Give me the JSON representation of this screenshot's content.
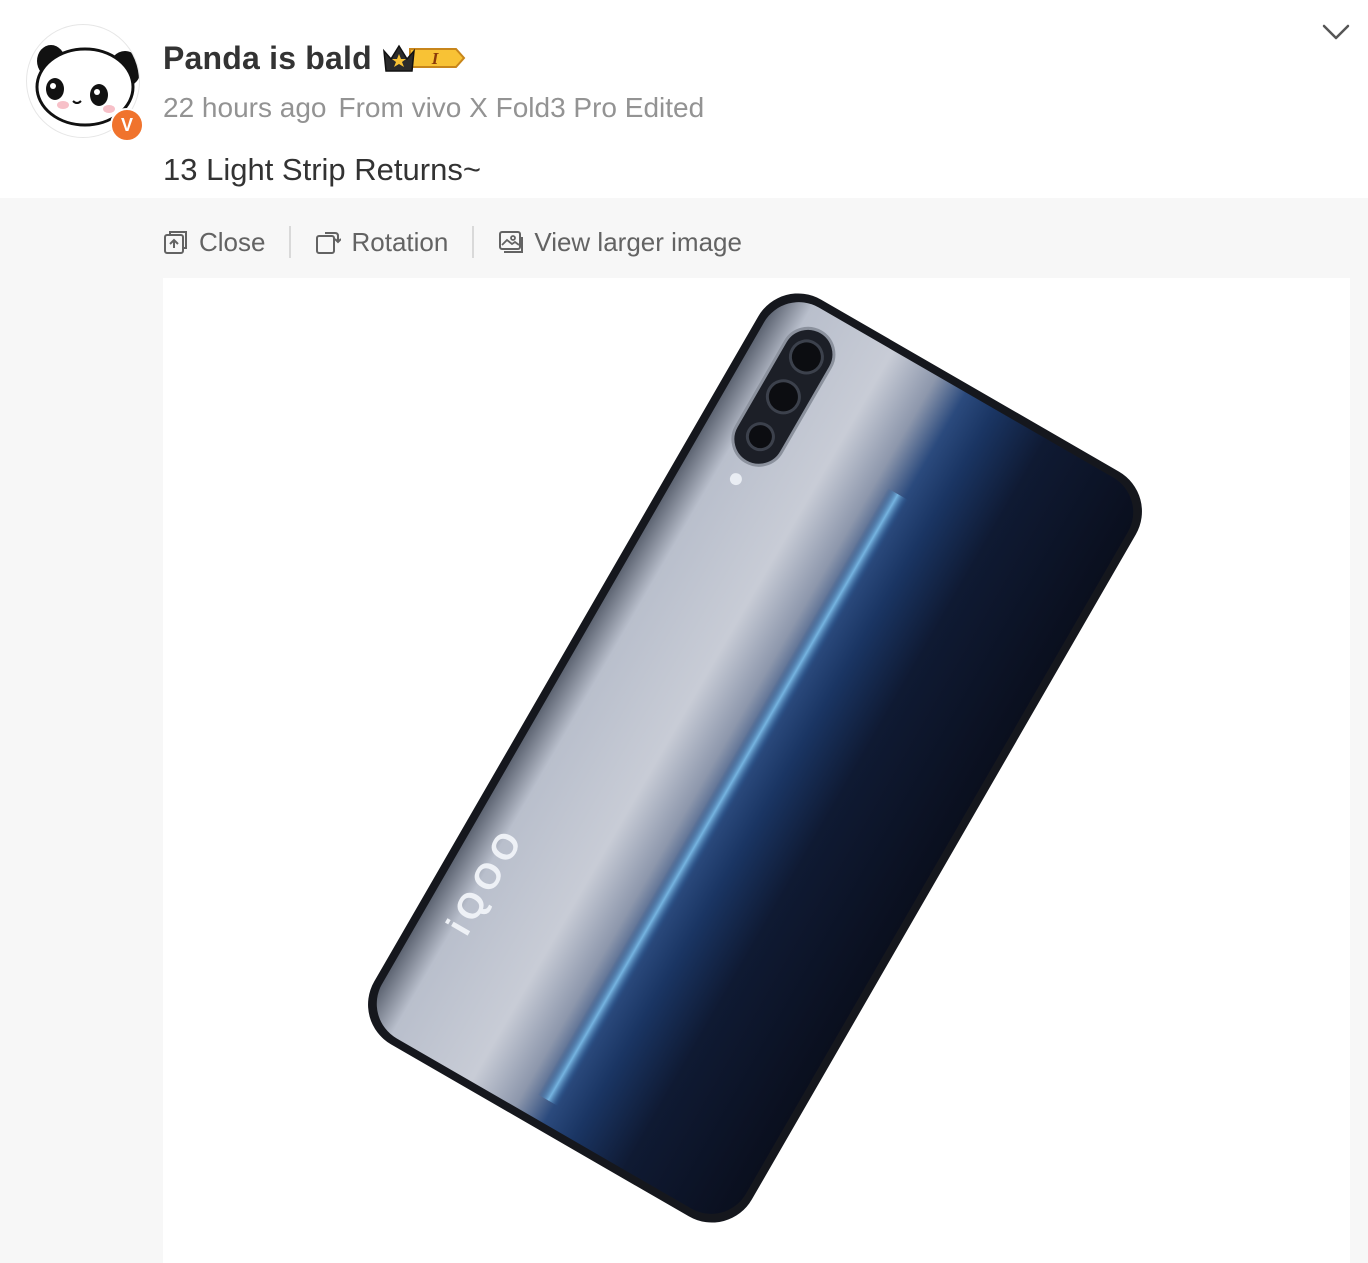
{
  "post": {
    "author": {
      "name": "Panda is bald",
      "verified_badge_letter": "V",
      "vip_badge_text": "I"
    },
    "meta": {
      "time": "22 hours ago",
      "source": "From vivo X Fold3 Pro Edited"
    },
    "text": "13 Light Strip Returns~"
  },
  "media_toolbar": {
    "close_label": "Close",
    "rotation_label": "Rotation",
    "view_larger_label": "View larger image"
  },
  "image": {
    "brand_text": "iQOO",
    "icon": "phone-photo"
  },
  "colors": {
    "accent_orange": "#f0732d",
    "panel_bg": "#f7f7f7",
    "text_primary": "#333333",
    "text_meta": "#939393",
    "text_toolbar": "#636363"
  }
}
